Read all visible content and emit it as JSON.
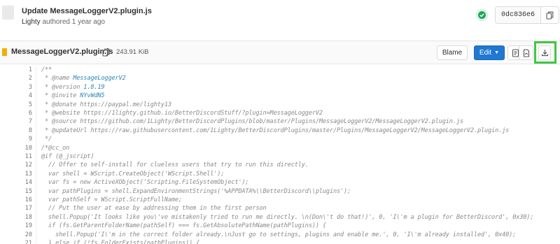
{
  "commit": {
    "title": "Update MessageLoggerV2.plugin.js",
    "author": "Lighty",
    "authored_text": "authored 1 year ago",
    "pipeline_status": "passed",
    "sha": "0dc836e6",
    "status_color": "#1aaa55"
  },
  "file": {
    "name": "MessageLoggerV2.plugin.js",
    "size": "243.91 KiB",
    "blame_label": "Blame",
    "edit_label": "Edit",
    "icons": [
      "copy-file-path-icon",
      "raw-file-icon",
      "download-pdf-icon",
      "download-icon"
    ],
    "accent_color": "#1f78d1",
    "highlight_color": "#3ec93e"
  },
  "code_lines": [
    {
      "n": "1",
      "text": "/**"
    },
    {
      "n": "2",
      "text": " * @name MessageLoggerV2",
      "highlight": "MessageLoggerV2"
    },
    {
      "n": "3",
      "text": " * @version 1.8.19",
      "highlight": "1.8.19"
    },
    {
      "n": "4",
      "text": " * @invite NYvWdN5",
      "highlight": "NYvWdN5"
    },
    {
      "n": "5",
      "text": " * @donate https://paypal.me/lighty13"
    },
    {
      "n": "6",
      "text": " * @website https://1lighty.github.io/BetterDiscordStuff/?plugin=MessageLoggerV2"
    },
    {
      "n": "7",
      "text": " * @source https://github.com/1Lighty/BetterDiscordPlugins/blob/master/Plugins/MessageLoggerV2/MessageLoggerV2.plugin.js"
    },
    {
      "n": "8",
      "text": " * @updateUrl https://raw.githubusercontent.com/1Lighty/BetterDiscordPlugins/master/Plugins/MessageLoggerV2/MessageLoggerV2.plugin.js"
    },
    {
      "n": "9",
      "text": " */"
    },
    {
      "n": "10",
      "text": "/*@cc_on"
    },
    {
      "n": "11",
      "text": "@if (@_jscript)"
    },
    {
      "n": "12",
      "text": "  // Offer to self-install for clueless users that try to run this directly."
    },
    {
      "n": "13",
      "text": "  var shell = WScript.CreateObject('WScript.Shell');"
    },
    {
      "n": "14",
      "text": "  var fs = new ActiveXObject('Scripting.FileSystemObject');"
    },
    {
      "n": "15",
      "text": "  var pathPlugins = shell.ExpandEnvironmentStrings('%APPDATA%\\\\BetterDiscord\\\\plugins');"
    },
    {
      "n": "16",
      "text": "  var pathSelf = WScript.ScriptFullName;"
    },
    {
      "n": "17",
      "text": "  // Put the user at ease by addressing them in the first person"
    },
    {
      "n": "18",
      "text": "  shell.Popup('It looks like you\\'ve mistakenly tried to run me directly. \\n(Don\\'t do that!)', 0, 'I\\'m a plugin for BetterDiscord', 0x30);"
    },
    {
      "n": "19",
      "text": "  if (fs.GetParentFolderName(pathSelf) === fs.GetAbsolutePathName(pathPlugins)) {"
    },
    {
      "n": "20",
      "text": "    shell.Popup('I\\'m in the correct folder already.\\nJust go to settings, plugins and enable me.', 0, 'I\\'m already installed', 0x40);"
    },
    {
      "n": "21",
      "text": "  } else if (!fs.FolderExists(pathPlugins)) {"
    }
  ]
}
